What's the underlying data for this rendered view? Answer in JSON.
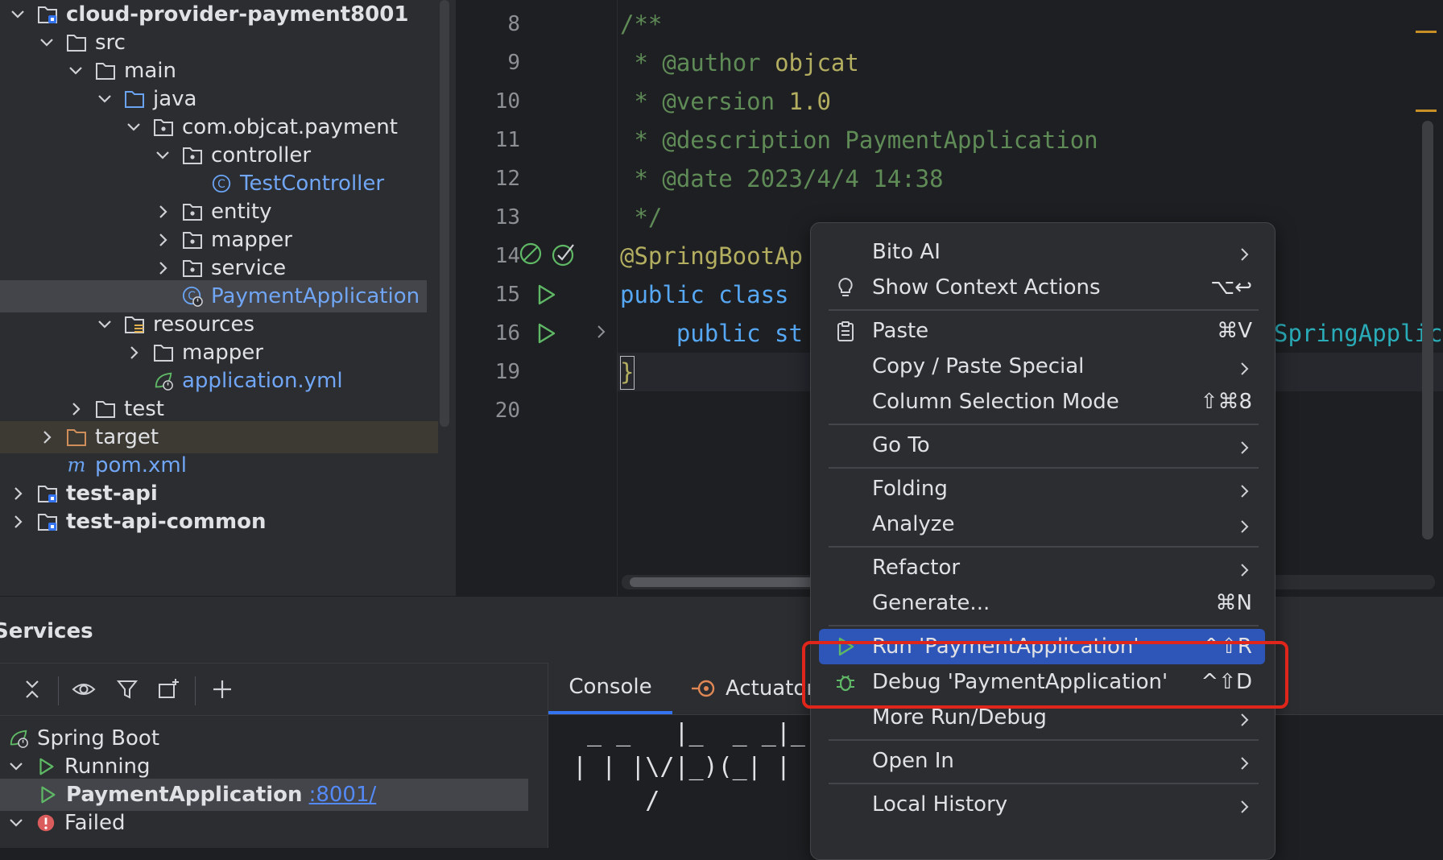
{
  "project_tree": [
    {
      "label": "cloud-provider-payment8001",
      "bold": true,
      "indent": 0,
      "chevron": "down",
      "icon": "module-folder-icon"
    },
    {
      "label": "src",
      "indent": 1,
      "chevron": "down",
      "icon": "folder-icon"
    },
    {
      "label": "main",
      "indent": 2,
      "chevron": "down",
      "icon": "folder-icon"
    },
    {
      "label": "java",
      "indent": 3,
      "chevron": "down",
      "icon": "source-folder-icon"
    },
    {
      "label": "com.objcat.payment",
      "indent": 4,
      "chevron": "down",
      "icon": "package-icon"
    },
    {
      "label": "controller",
      "indent": 5,
      "chevron": "down",
      "icon": "package-icon"
    },
    {
      "label": "TestController",
      "indent": 6,
      "chevron": "none",
      "icon": "class-icon",
      "blue": true
    },
    {
      "label": "entity",
      "indent": 5,
      "chevron": "right",
      "icon": "package-icon"
    },
    {
      "label": "mapper",
      "indent": 5,
      "chevron": "right",
      "icon": "package-icon"
    },
    {
      "label": "service",
      "indent": 5,
      "chevron": "right",
      "icon": "package-icon"
    },
    {
      "label": "PaymentApplication",
      "indent": 5,
      "chevron": "none",
      "icon": "spring-class-icon",
      "blue": true,
      "selected": true
    },
    {
      "label": "resources",
      "indent": 3,
      "chevron": "down",
      "icon": "resources-folder-icon"
    },
    {
      "label": "mapper",
      "indent": 4,
      "chevron": "right",
      "icon": "folder-icon"
    },
    {
      "label": "application.yml",
      "indent": 4,
      "chevron": "none",
      "icon": "spring-config-icon",
      "blue": true
    },
    {
      "label": "test",
      "indent": 2,
      "chevron": "right",
      "icon": "folder-icon"
    },
    {
      "label": "target",
      "indent": 1,
      "chevron": "right",
      "icon": "excluded-folder-icon",
      "target": true
    },
    {
      "label": "pom.xml",
      "indent": 1,
      "chevron": "none",
      "icon": "maven-icon",
      "blue": true
    },
    {
      "label": "test-api",
      "bold": true,
      "indent": 0,
      "chevron": "right",
      "icon": "module-folder-icon"
    },
    {
      "label": "test-api-common",
      "bold": true,
      "indent": 0,
      "chevron": "right",
      "icon": "module-folder-icon"
    }
  ],
  "editor": {
    "lines": [
      {
        "num": "8",
        "parts": [
          {
            "t": "/**",
            "c": "cm"
          }
        ]
      },
      {
        "num": "9",
        "parts": [
          {
            "t": " * ",
            "c": "cm"
          },
          {
            "t": "@author",
            "c": "cm"
          },
          {
            "t": " objcat",
            "c": "ann"
          }
        ]
      },
      {
        "num": "10",
        "parts": [
          {
            "t": " * ",
            "c": "cm"
          },
          {
            "t": "@version",
            "c": "cm"
          },
          {
            "t": " 1.0",
            "c": "ann"
          }
        ]
      },
      {
        "num": "11",
        "parts": [
          {
            "t": " * ",
            "c": "cm"
          },
          {
            "t": "@description",
            "c": "cm"
          },
          {
            "t": " PaymentApplication",
            "c": "cm"
          }
        ]
      },
      {
        "num": "12",
        "parts": [
          {
            "t": " * ",
            "c": "cm"
          },
          {
            "t": "@date",
            "c": "cm"
          },
          {
            "t": " 2023/4/4 14:38",
            "c": "cm"
          }
        ]
      },
      {
        "num": "13",
        "parts": [
          {
            "t": " */",
            "c": "cm"
          }
        ]
      },
      {
        "num": "14",
        "parts": [
          {
            "t": "@SpringBootAp",
            "c": "ann"
          }
        ]
      },
      {
        "num": "15",
        "parts": [
          {
            "t": "public class",
            "c": "ty"
          }
        ]
      },
      {
        "num": "16",
        "parts": [
          {
            "t": "    public st",
            "c": "ty"
          }
        ]
      },
      {
        "num": "19",
        "parts": [
          {
            "t": "}",
            "c": "ann"
          }
        ]
      },
      {
        "num": "20",
        "parts": []
      }
    ],
    "right_fragment": "SpringApplic"
  },
  "services": {
    "title": "Services",
    "tree": [
      {
        "label": "Spring Boot",
        "indent": 0,
        "chevron": "none",
        "icon": "spring-boot-icon"
      },
      {
        "label": "Running",
        "indent": 0,
        "chevron": "down",
        "icon": "run-icon"
      },
      {
        "label": "PaymentApplication",
        "indent": 1,
        "chevron": "none",
        "icon": "run-icon",
        "bold": true,
        "link": ":8001/",
        "selected": true
      },
      {
        "label": "Failed",
        "indent": 0,
        "chevron": "down",
        "icon": "error-icon"
      }
    ],
    "console_tabs": [
      "Console",
      "Actuator"
    ],
    "ascii_lines": [
      " _ _   |_  _ _|_. ___ _ |    _ ",
      "| | |\\/|_)(_| | |_\\  |_)||_|_\\ ",
      "     /"
    ]
  },
  "context_menu": {
    "items": [
      {
        "label": "Bito AI",
        "arrow": true
      },
      {
        "label": "Show Context Actions",
        "shortcut": "⌥↩",
        "icon": "bulb-icon"
      },
      {
        "sep": true
      },
      {
        "label": "Paste",
        "shortcut": "⌘V",
        "icon": "clipboard-icon"
      },
      {
        "label": "Copy / Paste Special",
        "arrow": true
      },
      {
        "label": "Column Selection Mode",
        "shortcut": "⇧⌘8"
      },
      {
        "sep": true
      },
      {
        "label": "Go To",
        "arrow": true
      },
      {
        "sep": true
      },
      {
        "label": "Folding",
        "arrow": true
      },
      {
        "label": "Analyze",
        "arrow": true
      },
      {
        "sep": true
      },
      {
        "label": "Refactor",
        "arrow": true
      },
      {
        "label": "Generate...",
        "shortcut": "⌘N"
      },
      {
        "sep": true
      },
      {
        "label": "Run 'PaymentApplication'",
        "shortcut": "^⇧R",
        "icon": "run-icon",
        "highlight": true
      },
      {
        "label": "Debug 'PaymentApplication'",
        "shortcut": "^⇧D",
        "icon": "debug-icon"
      },
      {
        "label": "More Run/Debug",
        "arrow": true
      },
      {
        "sep": true
      },
      {
        "label": "Open In",
        "arrow": true
      },
      {
        "sep": true
      },
      {
        "label": "Local History",
        "arrow": true
      }
    ]
  },
  "colors": {
    "accent": "#2e55b8",
    "highlight_outline": "#e0251b",
    "run_green": "#5fb865"
  }
}
